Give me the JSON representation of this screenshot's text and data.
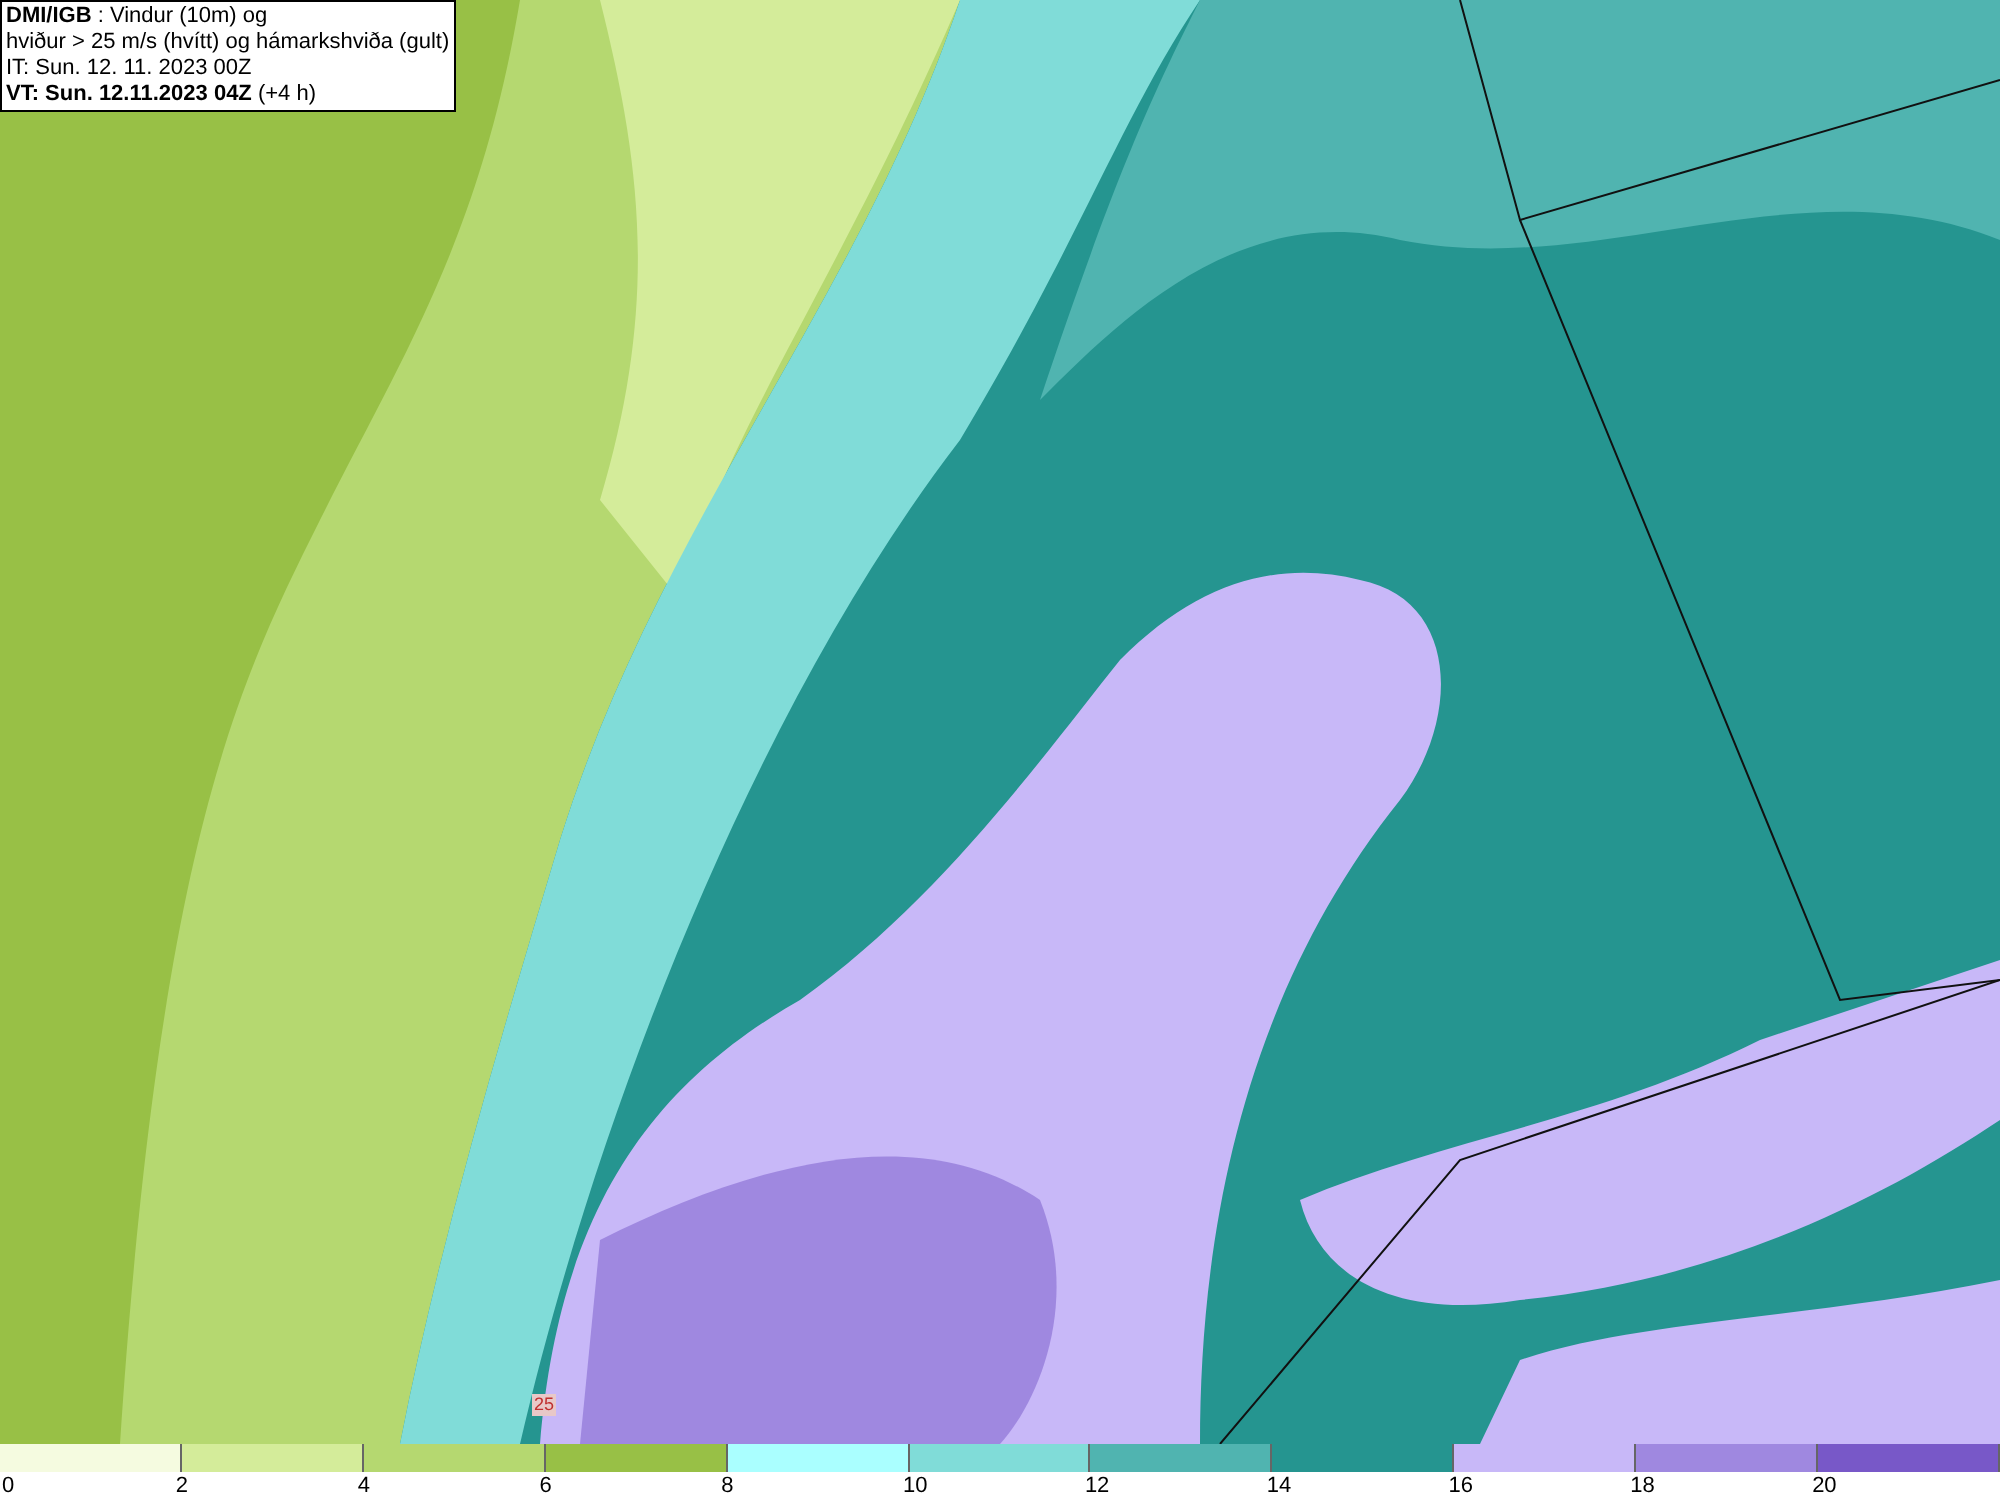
{
  "header": {
    "lines": [
      "**DMI/IGB** : Vindur (10m) og",
      "hviður > 25 m/s (hvítt) og hámarkshviða (gult)",
      "IT: Sun. 12. 11. 2023 00Z",
      "**VT: Sun. 12.11.2023 04Z** (+4 h)"
    ]
  },
  "contour_label": "25",
  "legend": [
    {
      "label": "0",
      "color": "#f5fbe0"
    },
    {
      "label": "2",
      "color": "#d4ec9a"
    },
    {
      "label": "4",
      "color": "#b5d870"
    },
    {
      "label": "6",
      "color": "#98c046"
    },
    {
      "label": "8",
      "color": "#aaffff"
    },
    {
      "label": "10",
      "color": "#80dcd8"
    },
    {
      "label": "12",
      "color": "#50b4b0"
    },
    {
      "label": "14",
      "color": "#259590"
    },
    {
      "label": "16",
      "color": "#c8b8f8"
    },
    {
      "label": "18",
      "color": "#9f88e0"
    },
    {
      "label": "20",
      "color": "#7858c8"
    }
  ]
}
